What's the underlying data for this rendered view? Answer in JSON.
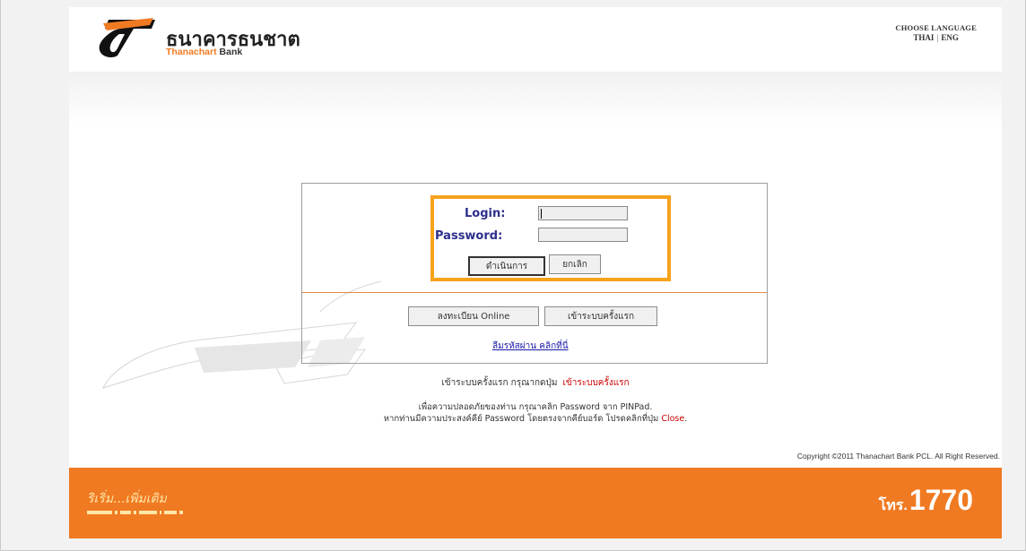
{
  "header": {
    "bank_name_th": "ธนาคารธนชาต",
    "bank_name_en_prefix": "Thanachart",
    "bank_name_en_suffix": "Bank",
    "choose_language": "CHOOSE LANGUAGE",
    "lang_thai": "THAI",
    "lang_eng": "ENG"
  },
  "login": {
    "login_label": "Login:",
    "password_label": "Password:",
    "login_value": "",
    "password_value": "",
    "submit_label": "ดำเนินการ",
    "cancel_label": "ยกเลิก"
  },
  "actions": {
    "register_label": "ลงทะเบียน  Online",
    "first_time_label": "เข้าระบบครั้งแรก",
    "forgot_password": "ลืมรหัสผ่าน คลิกที่นี่"
  },
  "notes": {
    "first_time_text": "เข้าระบบครั้งแรก  กรุณากดปุ่ม",
    "first_time_link": "เข้าระบบครั้งแรก",
    "security_line1": "เพื่อความปลอดภัยของท่าน  กรุณาคลิก  Password จาก  PINPad.",
    "security_line2": "หากท่านมีความประสงค์คีย์ Password โดยตรงจากคีย์บอร์ด  โปรดคลิกที่ปุ่ม",
    "close_link": "Close",
    "close_suffix": "."
  },
  "copyright": "Copyright ©2011 Thanachart Bank PCL. All Right Reserved.",
  "footer": {
    "slogan": "ริเริ่ม...เพิ่มเติม",
    "tel_prefix": "โทร.",
    "tel_number": "1770"
  },
  "colors": {
    "brand_orange": "#f07a22",
    "highlight": "#f7a21b",
    "label_blue": "#2e2f8c",
    "link_red": "#cc0000"
  }
}
